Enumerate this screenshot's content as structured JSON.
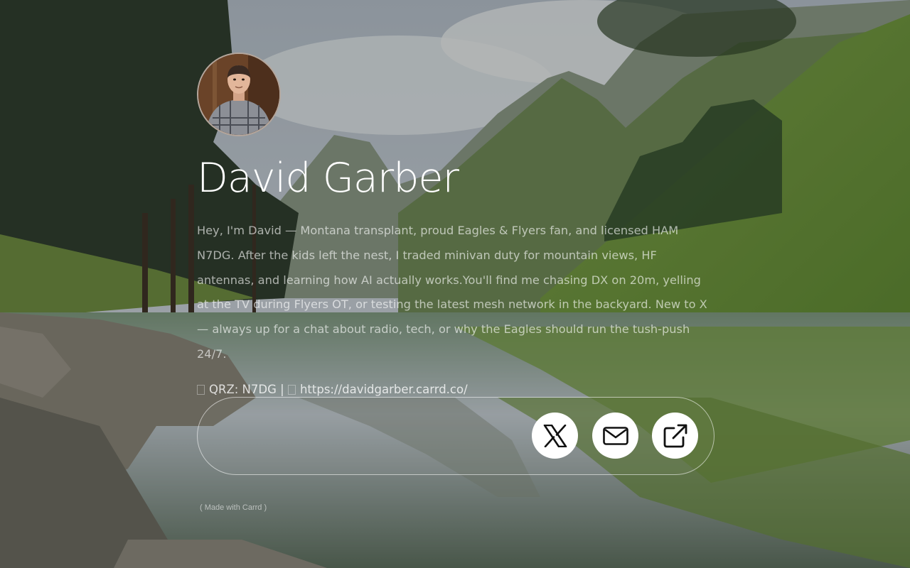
{
  "profile": {
    "name": "David Garber",
    "bio": "Hey, I'm David — Montana transplant, proud Eagles & Flyers fan, and licensed HAM N7DG. After the kids left the nest, I traded minivan duty for mountain views, HF antennas, and learning how AI actually works.You'll find me chasing DX on 20m, yelling at the TV during Flyers OT, or testing the latest mesh network in the backyard. New to X — always up for a chat about radio, tech, or why the Eagles should run the tush-push 24/7.",
    "qrz_label": "QRZ: N7DG",
    "separator": "|",
    "website_label": "https://davidgarber.carrd.co/"
  },
  "social": {
    "x_icon": "x-logo-icon",
    "email_icon": "envelope-icon",
    "external_icon": "external-link-icon"
  },
  "footer": {
    "made_with": "( Made with Carrd )"
  },
  "colors": {
    "text": "#ffffff",
    "button_bg": "#ffffff",
    "icon": "#111111"
  }
}
